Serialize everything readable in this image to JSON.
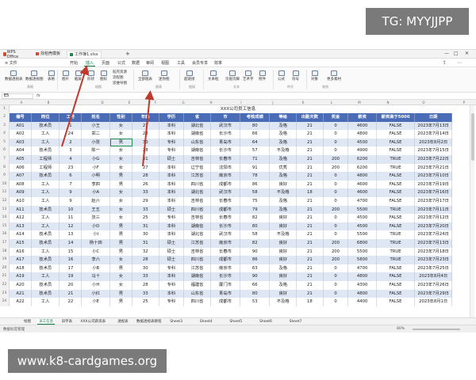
{
  "watermarks": {
    "top_right": "TG: MYYJJPP",
    "bottom_left": "www.k8-cardgames.org"
  },
  "titlebar": {
    "app_name": "WPS Office",
    "tabs": [
      "找稻壳模板",
      "工作簿1.xlsx"
    ],
    "add_tab": "+"
  },
  "menubar": {
    "file": "≡ 文件",
    "items": [
      "开始",
      "插入",
      "页面",
      "公式",
      "数据",
      "审阅",
      "视图",
      "工具",
      "会员专享",
      "效率"
    ],
    "active": "插入"
  },
  "ribbon": {
    "buttons": [
      "数据透视表",
      "数据透视图",
      "表格",
      "图片",
      "截屏",
      "形状",
      "图标",
      "稻壳资源",
      "流程图",
      "思维导图",
      "全部图表",
      "迷你图",
      "超链接",
      "文本框",
      "页眉页脚",
      "艺术字",
      "附件",
      "公式",
      "符号",
      "对象",
      "更多素材"
    ],
    "groups": [
      "表格",
      "插图",
      "图表",
      "链接",
      "文本",
      "符号",
      "其他"
    ]
  },
  "formula_bar": {
    "name_box": "E5",
    "fx": "fx"
  },
  "col_letters": [
    "A",
    "B",
    "C",
    "D",
    "E",
    "F",
    "G",
    "H",
    "I",
    "J",
    "K",
    "L",
    "M",
    "N",
    "O",
    "P"
  ],
  "sheet": {
    "title": "XXX公司员工信息",
    "headers": [
      "编号",
      "岗位",
      "工号",
      "姓名",
      "性别",
      "年龄",
      "学历",
      "省",
      "市",
      "考核成绩",
      "等级",
      "出勤天数",
      "奖金",
      "薪资",
      "薪资高于5000",
      "日期"
    ],
    "rows": [
      [
        "A01",
        "技术员",
        "1",
        "小王",
        "女",
        "27",
        "本科",
        "湖北省",
        "武汉市",
        "80",
        "及格",
        "21",
        "0",
        "4600",
        "FALSE",
        "2023年7月13日"
      ],
      [
        "A02",
        "工人",
        "24",
        "郑二",
        "女",
        "28",
        "本科",
        "湖南省",
        "长沙市",
        "66",
        "及格",
        "21",
        "0",
        "4800",
        "FALSE",
        "2023年7月14日"
      ],
      [
        "A03",
        "工人",
        "2",
        "小张",
        "男",
        "30",
        "专科",
        "山东省",
        "青岛市",
        "64",
        "及格",
        "21",
        "0",
        "4500",
        "FALSE",
        "2023年8月2日"
      ],
      [
        "A04",
        "技术员",
        "3",
        "陈一",
        "女",
        "28",
        "专科",
        "湖南省",
        "长沙市",
        "57",
        "不及格",
        "21",
        "0",
        "4900",
        "FALSE",
        "2023年7月15日"
      ],
      [
        "A05",
        "工程师",
        "4",
        "小G",
        "女",
        "31",
        "硕士",
        "吉林省",
        "长春市",
        "71",
        "及格",
        "21",
        "200",
        "6200",
        "TRUE",
        "2023年7月22日"
      ],
      [
        "A06",
        "工程师",
        "23",
        "小F",
        "女",
        "27",
        "本科",
        "辽宁省",
        "沈阳市",
        "91",
        "优秀",
        "21",
        "200",
        "6200",
        "TRUE",
        "2023年7月21日"
      ],
      [
        "A07",
        "技术员",
        "6",
        "小明",
        "男",
        "28",
        "本科",
        "江苏省",
        "南京市",
        "78",
        "及格",
        "21",
        "0",
        "4800",
        "FALSE",
        "2023年7月10日"
      ],
      [
        "A08",
        "工人",
        "7",
        "李四",
        "男",
        "26",
        "本科",
        "四川省",
        "成都市",
        "86",
        "良好",
        "21",
        "0",
        "4600",
        "FALSE",
        "2023年7月19日"
      ],
      [
        "A09",
        "工人",
        "9",
        "小A",
        "女",
        "33",
        "本科",
        "湖北省",
        "武汉市",
        "58",
        "不及格",
        "18",
        "0",
        "4600",
        "FALSE",
        "2023年7月16日"
      ],
      [
        "A10",
        "工人",
        "9",
        "赵六",
        "女",
        "29",
        "本科",
        "吉林省",
        "长春市",
        "75",
        "及格",
        "21",
        "0",
        "4700",
        "FALSE",
        "2023年7月17日"
      ],
      [
        "A11",
        "技术员",
        "10",
        "王五",
        "女",
        "33",
        "硕士",
        "四川省",
        "成都市",
        "79",
        "及格",
        "21",
        "200",
        "5500",
        "TRUE",
        "2023年7月11日"
      ],
      [
        "A12",
        "工人",
        "11",
        "张三",
        "女",
        "25",
        "专科",
        "吉林省",
        "长春市",
        "82",
        "良好",
        "21",
        "0",
        "4500",
        "FALSE",
        "2023年7月12日"
      ],
      [
        "A13",
        "工人",
        "12",
        "小D",
        "男",
        "31",
        "本科",
        "湖南省",
        "长沙市",
        "80",
        "良好",
        "21",
        "0",
        "4500",
        "FALSE",
        "2023年7月20日"
      ],
      [
        "A14",
        "技术员",
        "13",
        "小I",
        "男",
        "30",
        "本科",
        "湖北省",
        "武汉市",
        "58",
        "不及格",
        "21",
        "0",
        "5500",
        "TRUE",
        "2023年7月24日"
      ],
      [
        "A15",
        "技术员",
        "14",
        "杨十四",
        "男",
        "31",
        "硕士",
        "江苏省",
        "南京市",
        "82",
        "良好",
        "21",
        "200",
        "6800",
        "TRUE",
        "2023年7月13日"
      ],
      [
        "A16",
        "工人",
        "15",
        "小C",
        "男",
        "32",
        "硕士",
        "吉林省",
        "长春市",
        "90",
        "良好",
        "21",
        "200",
        "5500",
        "TRUE",
        "2023年7月18日"
      ],
      [
        "A17",
        "技术员",
        "16",
        "李六",
        "女",
        "28",
        "硕士",
        "四川省",
        "成都市",
        "86",
        "良好",
        "21",
        "200",
        "5800",
        "TRUE",
        "2023年7月23日"
      ],
      [
        "A18",
        "技术员",
        "17",
        "小B",
        "男",
        "30",
        "专科",
        "江苏省",
        "南京市",
        "63",
        "及格",
        "21",
        "0",
        "4700",
        "FALSE",
        "2023年7月25日"
      ],
      [
        "A19",
        "工人",
        "19",
        "马十",
        "女",
        "33",
        "本科",
        "湖南省",
        "长沙市",
        "90",
        "良好",
        "21",
        "0",
        "4800",
        "FALSE",
        "2023年8月4日"
      ],
      [
        "A20",
        "技术员",
        "20",
        "小H",
        "女",
        "28",
        "专科",
        "福建省",
        "厦门市",
        "66",
        "及格",
        "21",
        "0",
        "4300",
        "FALSE",
        "2023年7月26日"
      ],
      [
        "A21",
        "技术员",
        "21",
        "小红",
        "男",
        "33",
        "本科",
        "山东省",
        "青岛市",
        "80",
        "良好",
        "21",
        "0",
        "4800",
        "FALSE",
        "2023年7月29日"
      ],
      [
        "A22",
        "工人",
        "22",
        "小E",
        "男",
        "25",
        "专科",
        "四川省",
        "成都市",
        "53",
        "不及格",
        "18",
        "0",
        "4400",
        "FALSE",
        "2023年8月1日"
      ]
    ]
  },
  "sheet_tabs": [
    "绘图",
    "员工信息",
    "旧字表",
    "XXX公司薪资表",
    "透视表",
    "数据透视表教程",
    "Sheet3",
    "Sheet4",
    "Sheet5",
    "Sheet6",
    "Sheet7"
  ],
  "statusbar": {
    "left": "数据标签管理",
    "zoom": "80%"
  }
}
